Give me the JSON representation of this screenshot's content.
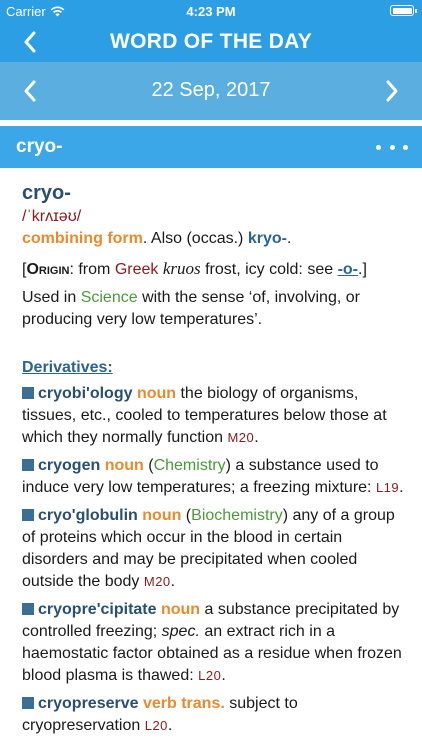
{
  "status": {
    "carrier": "Carrier",
    "time": "4:23 PM"
  },
  "nav": {
    "title": "WORD OF THE DAY"
  },
  "date_bar": {
    "date": "22 Sep, 2017"
  },
  "word_bar": {
    "word": "cryo-"
  },
  "entry": {
    "headword": "cryo-",
    "pronunciation": "/ˈkrʌɪəʊ/",
    "pos": "combining form",
    "also_text": ". Also (occas.) ",
    "also_form": "kryo-",
    "also_end": ".",
    "origin_open": "[",
    "origin_label": "Origin",
    "origin_from": ": from ",
    "origin_lang": "Greek",
    "origin_lemma": "kruos",
    "origin_gloss": " frost, icy cold: see ",
    "origin_link": "-o-",
    "origin_close": ".]",
    "sense_1": "Used in ",
    "sense_domain": "Science",
    "sense_2": " with the sense ‘of, involving, or producing very low temperatures’."
  },
  "derivatives": {
    "header": "Derivatives:",
    "items": [
      {
        "word": "cryobi'ology",
        "pos": "noun",
        "def": " the biology of organisms, tissues, etc., cooled to temperatures below those at which they normally function ",
        "date": "M20",
        "end": "."
      },
      {
        "word": "cryogen",
        "pos": "noun",
        "domain_open": " (",
        "domain": "Chemistry",
        "domain_close": ")",
        "def": " a substance used to induce very low temperatures; a freezing mixture: ",
        "date": "L19",
        "end": "."
      },
      {
        "word": "cryo'globulin",
        "pos": "noun",
        "domain_open": " (",
        "domain": "Biochemistry",
        "domain_close": ")",
        "def": " any of a group of proteins which occur in the blood in certain disorders and may be precipitated when cooled outside the body ",
        "date": "M20",
        "end": "."
      },
      {
        "word": "cryopre'cipitate",
        "pos": "noun",
        "def_1": " a substance precipitated by controlled freezing; ",
        "spec": "spec.",
        "def_2": " an extract rich in a haemostatic factor obtained as a residue when frozen blood plasma is thawed: ",
        "date": "L20",
        "end": "."
      },
      {
        "word": "cryopreserve",
        "pos": "verb trans.",
        "def": " subject to cryopreservation ",
        "date": "L20",
        "end": "."
      }
    ]
  }
}
